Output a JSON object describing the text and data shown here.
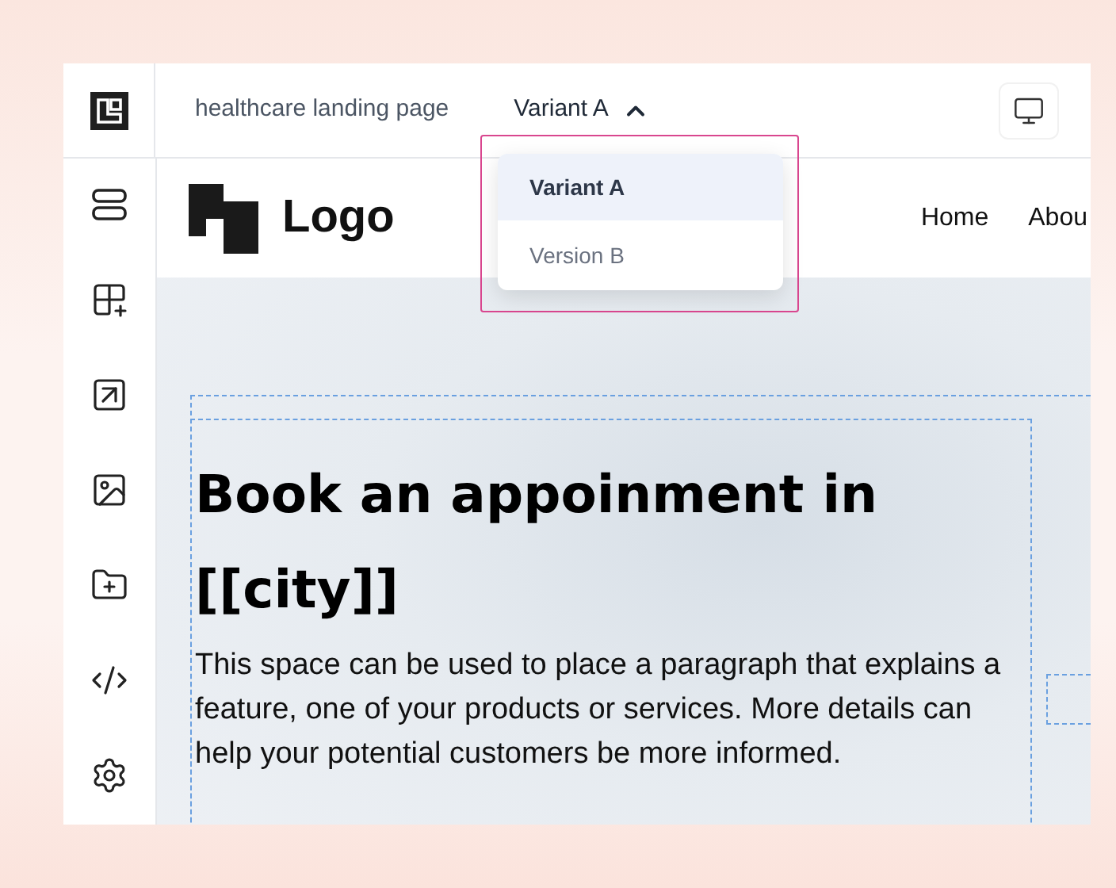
{
  "toolbar": {
    "page_name": "healthcare landing page",
    "variant_switch": {
      "label": "Variant A",
      "expanded": true
    }
  },
  "variant_menu": [
    {
      "label": "Variant A",
      "selected": true
    },
    {
      "label": "Version B",
      "selected": false
    }
  ],
  "site_header": {
    "logo": "Logo",
    "nav": [
      "Home",
      "Abou"
    ]
  },
  "hero": {
    "heading": "Book an appoinment in [[city]]",
    "paragraph": "This space can be used to place a paragraph that explains a feature, one of your products or services. More details can help your potential customers be more informed."
  }
}
